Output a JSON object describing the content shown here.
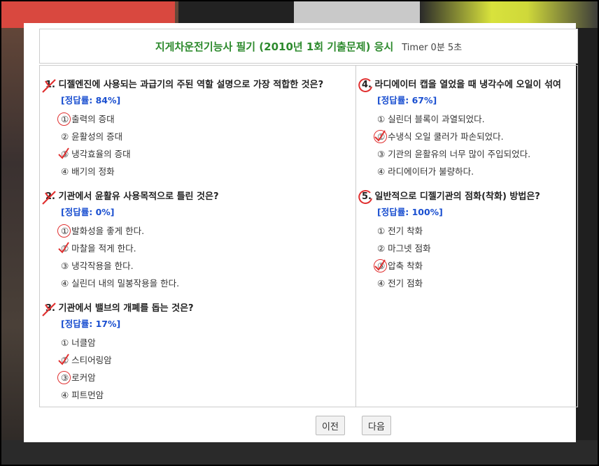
{
  "header": {
    "title": "지게차운전기능사 필기 (2010년 1회 기출문제) 응시",
    "timer": "Timer 0분 5초"
  },
  "questions": [
    {
      "id": "q1",
      "label": "1.",
      "text": "디젤엔진에 사용되는 과급기의 주된 역할 설명으로 가장 적합한 것은?",
      "rate": "[정답률: 84%]",
      "options": [
        "① 출력의 증대",
        "② 윤활성의 증대",
        "③ 냉각효율의 증대",
        "④ 배기의 정화"
      ]
    },
    {
      "id": "q2",
      "label": "2.",
      "text": "기관에서 윤활유 사용목적으로 틀린 것은?",
      "rate": "[정답률: 0%]",
      "options": [
        "① 발화성을 좋게 한다.",
        "② 마찰을 적게 한다.",
        "③ 냉각작용을 한다.",
        "④ 실린더 내의 밀봉작용을 한다."
      ]
    },
    {
      "id": "q3",
      "label": "3.",
      "text": "기관에서 밸브의 개폐를 돕는 것은?",
      "rate": "[정답률: 17%]",
      "options": [
        "① 너클암",
        "② 스티어링암",
        "③ 로커암",
        "④ 피트먼암"
      ]
    },
    {
      "id": "q4",
      "label": "4.",
      "text": "라디에이터 캡을 열었을 때 냉각수에 오일이 섞여",
      "rate": "[정답률: 67%]",
      "options": [
        "① 실린더 블록이 과열되었다.",
        "② 수냉식 오일 쿨러가 파손되었다.",
        "③ 기관의 윤활유의 너무 많이 주입되었다.",
        "④ 라디에이터가 불량하다."
      ]
    },
    {
      "id": "q5",
      "label": "5.",
      "text": "일반적으로 디젤기관의 점화(착화) 방법은?",
      "rate": "[정답률: 100%]",
      "options": [
        "① 전기 착화",
        "② 마그넷 점화",
        "③ 압축 착화",
        "④ 전기 점화"
      ]
    }
  ],
  "footer": {
    "prev_label": "이전",
    "next_label": "다음"
  },
  "colors": {
    "title": "#2d8a2d",
    "rate": "#1a4fd0",
    "mark": "#e03030"
  }
}
